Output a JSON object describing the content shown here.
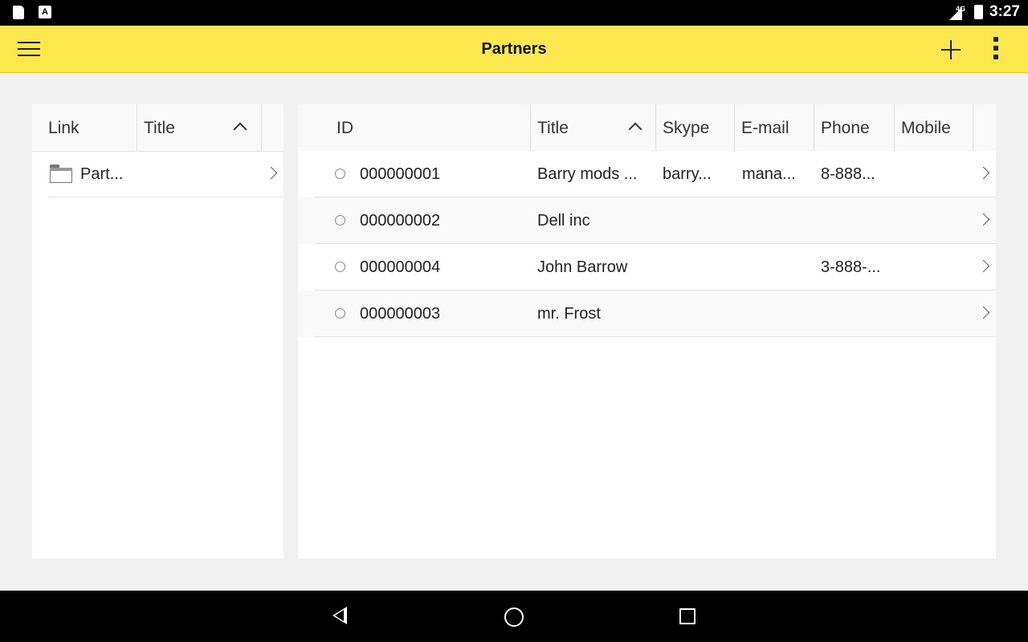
{
  "status_bar": {
    "network": "4G",
    "time": "3:27",
    "a_icon_label": "A"
  },
  "app_bar": {
    "title": "Partners",
    "icons": {
      "menu": "hamburger-menu-icon",
      "add": "plus-icon",
      "more": "more-vertical-icon"
    }
  },
  "left_table": {
    "columns": [
      "Link",
      "Title"
    ],
    "sorted_column": "Title",
    "rows": [
      {
        "icon": "folder-icon",
        "title": "Part..."
      }
    ]
  },
  "right_table": {
    "columns": [
      "ID",
      "Title",
      "Skype",
      "E-mail",
      "Phone",
      "Mobile"
    ],
    "sorted_column": "Title",
    "rows": [
      {
        "id": "000000001",
        "title": "Barry mods ...",
        "skype": "barry...",
        "email": "mana...",
        "phone": "8-888...",
        "mobile": ""
      },
      {
        "id": "000000002",
        "title": "Dell inc",
        "skype": "",
        "email": "",
        "phone": "",
        "mobile": ""
      },
      {
        "id": "000000004",
        "title": "John Barrow",
        "skype": "",
        "email": "",
        "phone": "3-888-...",
        "mobile": ""
      },
      {
        "id": "000000003",
        "title": "mr. Frost",
        "skype": "",
        "email": "",
        "phone": "",
        "mobile": ""
      }
    ]
  },
  "colors": {
    "app_bar": "#fde74f",
    "background": "#f1f1f1",
    "system_bars": "#000000"
  }
}
